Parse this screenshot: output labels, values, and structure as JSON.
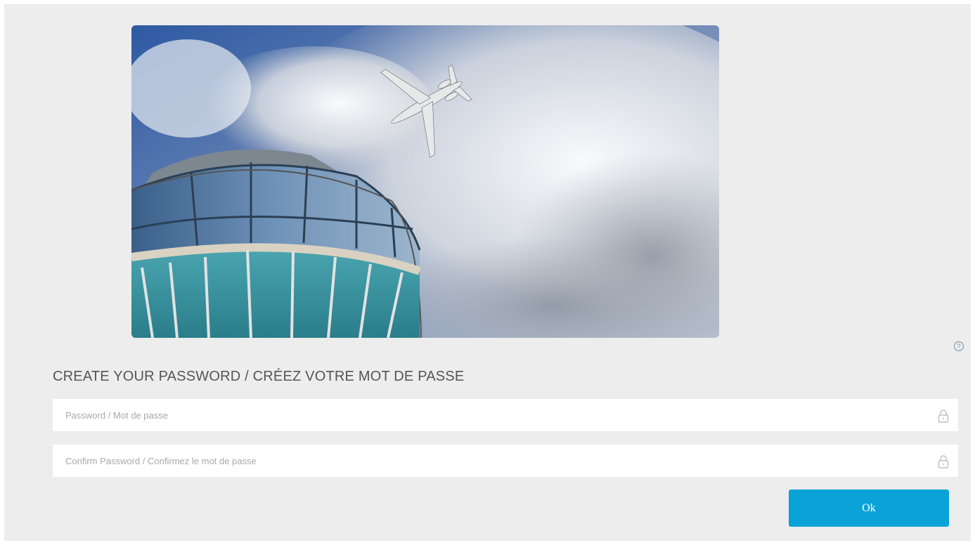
{
  "hero": {
    "image": "air-traffic-control-tower-with-airplane"
  },
  "help": {
    "icon": "help-icon",
    "glyph": "?"
  },
  "form": {
    "title": "CREATE YOUR PASSWORD / CRÉEZ VOTRE MOT DE PASSE",
    "password": {
      "placeholder": "Password / Mot de passe",
      "value": "",
      "icon": "lock-icon"
    },
    "confirm": {
      "placeholder": "Confirm Password / Confirmez le mot de passe",
      "value": "",
      "icon": "lock-icon"
    },
    "ok_label": "Ok"
  },
  "colors": {
    "accent": "#0aa3d8",
    "background": "#ededed",
    "help": "#6a8fa8"
  }
}
